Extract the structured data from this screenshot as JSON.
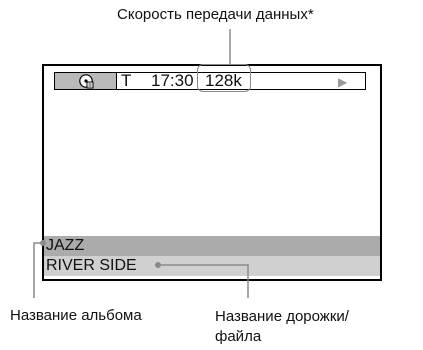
{
  "callouts": {
    "bitrate": "Скорость передачи данных*",
    "album": "Название альбома",
    "track_line1": "Название дорожки/",
    "track_line2": "файла"
  },
  "display": {
    "status": {
      "icon": "disc-icon",
      "mode": "T",
      "time": "17:30",
      "bitrate": "128k",
      "play_icon": "play-triangle-icon"
    },
    "album_name": "JAZZ",
    "track_name": "RIVER SIDE"
  },
  "colors": {
    "album_bar": "#ababab",
    "track_bar": "#d0d0d0",
    "icon_cell": "#b9b9b9",
    "callout_box": "#8a8a8a"
  }
}
